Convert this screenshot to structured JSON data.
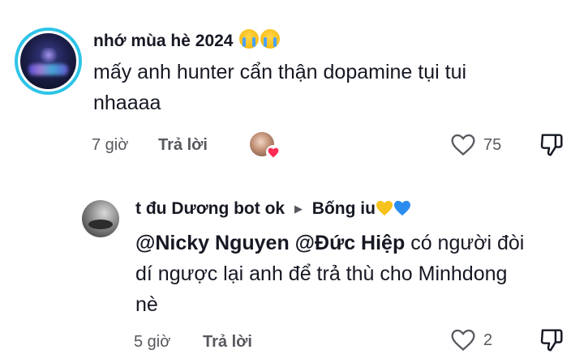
{
  "comment": {
    "username": "nhớ mùa hè 2024",
    "text_line1": "mấy anh hunter cẩn thận dopamine tụi tui",
    "text_line2": "nhaaaa",
    "time": "7 giờ",
    "reply_label": "Trả lời",
    "like_count": "75"
  },
  "reply": {
    "username": "t đu Dương bot ok",
    "reply_to": "Bống iu",
    "mention1": "@Nicky Nguyen",
    "mention2": "@Đức Hiệp",
    "text_line1_rest": "có người đòi",
    "text_line2": "dí ngược lại anh để trả thù cho Minhdong",
    "text_line3": "nè",
    "time": "5 giờ",
    "reply_label": "Trả lời",
    "like_count": "2"
  },
  "colors": {
    "avatar_ring": "#2ec4e8",
    "primary_text": "#161823",
    "secondary_text": "#57585f",
    "heart_red": "#fe2c55"
  }
}
